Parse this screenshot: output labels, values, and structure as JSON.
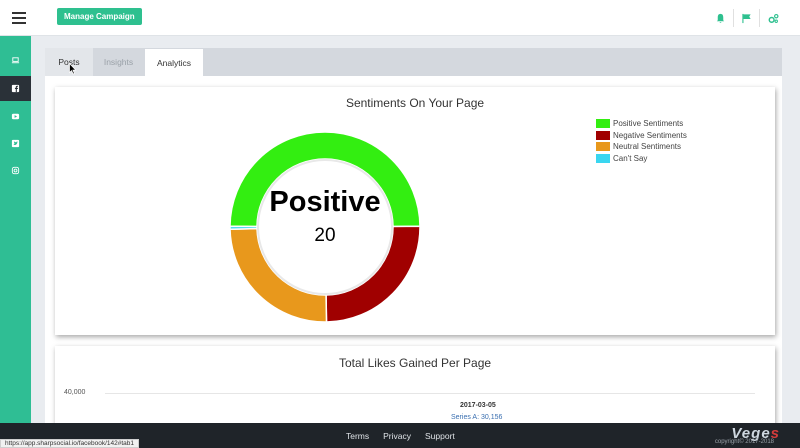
{
  "topbar": {
    "manage_campaign_label": "Manage Campaign",
    "icons": [
      "bell-icon",
      "flag-icon",
      "cogs-icon"
    ]
  },
  "sidebar": {
    "items": [
      {
        "icon": "laptop-icon"
      },
      {
        "icon": "facebook-icon",
        "active": true
      },
      {
        "icon": "youtube-icon"
      },
      {
        "icon": "twitter-icon"
      },
      {
        "icon": "instagram-icon"
      }
    ]
  },
  "tabs": [
    {
      "label": "Posts"
    },
    {
      "label": "Insights"
    },
    {
      "label": "Analytics",
      "active": true
    }
  ],
  "colors": {
    "accent": "#2ec08f",
    "sidebar_active": "#2a3138",
    "footer_bg": "#1f2429"
  },
  "chart_data": [
    {
      "type": "pie",
      "title": "Sentiments On Your Page",
      "center_label": "Positive",
      "center_value": "20",
      "legend_position": "top-right",
      "series": [
        {
          "name": "Positive Sentiments",
          "value": 20,
          "color": "#33ee11"
        },
        {
          "name": "Negative Sentiments",
          "value": 10,
          "color": "#a00000"
        },
        {
          "name": "Neutral Sentiments",
          "value": 10,
          "color": "#e8981c"
        },
        {
          "name": "Can't Say",
          "value": 0.2,
          "color": "#3ad6f0"
        }
      ]
    },
    {
      "type": "line",
      "title": "Total Likes Gained Per Page",
      "y_ticks": [
        "40,000"
      ],
      "tooltip": {
        "date": "2017-03-05",
        "series": "Series A: 30,156"
      }
    }
  ],
  "footer": {
    "links": [
      "Terms",
      "Privacy",
      "Support"
    ],
    "brand_main": "Vege",
    "brand_accent": "s",
    "copyright": "copyright© 2017-2018"
  },
  "status_url": "https://app.sharpsocial.io/facebook/142#tab1"
}
